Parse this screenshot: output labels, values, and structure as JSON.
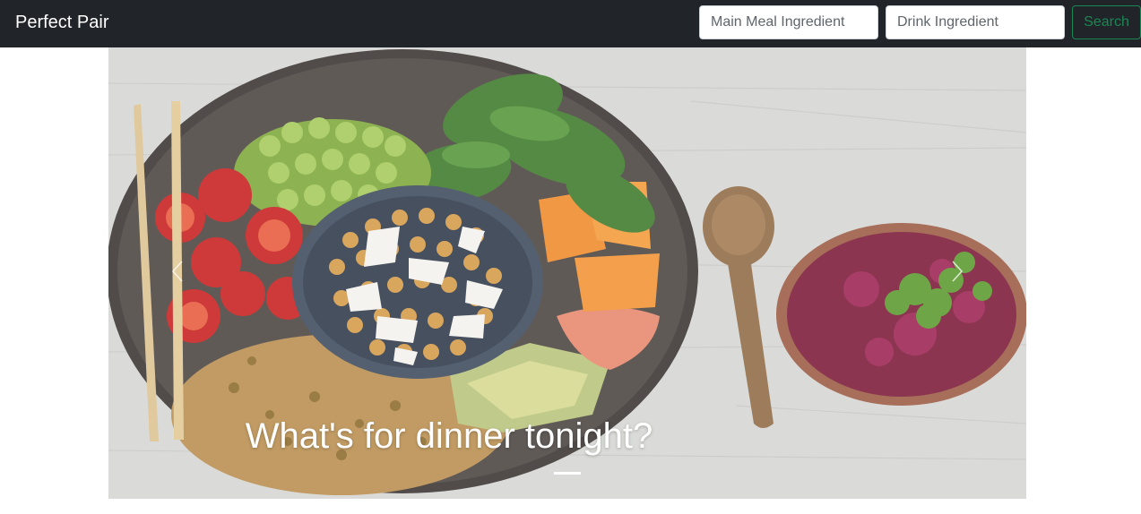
{
  "navbar": {
    "brand": "Perfect Pair",
    "meal_input": {
      "placeholder": "Main Meal Ingredient",
      "value": ""
    },
    "drink_input": {
      "placeholder": "Drink Ingredient",
      "value": ""
    },
    "search_label": "Search"
  },
  "carousel": {
    "slides": [
      {
        "caption": "What's for dinner tonight?",
        "image": "overhead photo of a buddha bowl with chickpeas, feta, cherry tomatoes, edamame, spinach, persimmon, avocado, salmon and rice beside chopsticks, a wooden spoon and a bowl of beetroot dip"
      }
    ],
    "active_index": 0,
    "prev_icon": "chevron-left-icon",
    "next_icon": "chevron-right-icon"
  },
  "colors": {
    "navbar_bg": "#212529",
    "accent_success": "#198754",
    "table_bg": "#d8d8d6"
  }
}
